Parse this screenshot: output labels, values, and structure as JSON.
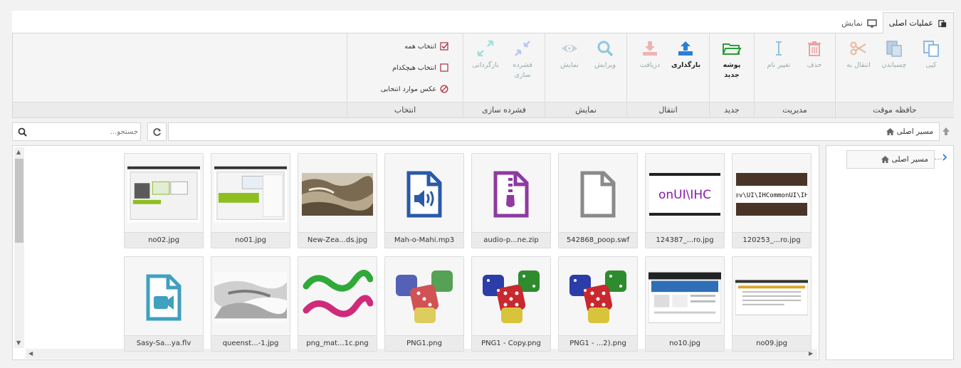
{
  "tabs": [
    {
      "label": "عملیات اصلی",
      "icon": "clipboard-icon",
      "active": true
    },
    {
      "label": "نمایش",
      "icon": "monitor-icon",
      "active": false
    }
  ],
  "ribbon": {
    "groups": {
      "clipboard": {
        "title": "حافظه موقت",
        "copy": "کپی",
        "paste": "چسباندن",
        "move": "انتقال به"
      },
      "manage": {
        "title": "مدیریت",
        "delete": "حذف",
        "rename": "تغییر نام"
      },
      "new": {
        "title": "جدید",
        "new_folder": "پوشه جدید"
      },
      "transfer": {
        "title": "انتقال",
        "upload": "بارگذاری",
        "download": "دریافت"
      },
      "view": {
        "title": "نمایش",
        "edit": "ویرایش",
        "show": "نمایش"
      },
      "compress": {
        "title": "فشرده سازی",
        "compress": "فشرده سازی",
        "extract": "بازگردانی"
      },
      "select": {
        "title": "انتخاب",
        "select_all": "انتخاب همه",
        "select_none": "انتخاب هیچکدام",
        "invert": "عکس موارد انتخابی"
      }
    }
  },
  "address": {
    "breadcrumb": "مسیر اصلی"
  },
  "search": {
    "placeholder": "جستجو..."
  },
  "tree": {
    "root": "مسیر اصلی"
  },
  "files": [
    {
      "name": "120253_...ro.jpg",
      "kind": "banner-ihc-image"
    },
    {
      "name": "124387_...ro.jpg",
      "kind": "banner-ihc-purple-image"
    },
    {
      "name": "542868_poop.swf",
      "kind": "blank-file-icon"
    },
    {
      "name": "audio-p...ne.zip",
      "kind": "zip-file-icon"
    },
    {
      "name": "Mah-o-Mahi.mp3",
      "kind": "audio-file-icon"
    },
    {
      "name": "New-Zea...ds.jpg",
      "kind": "landscape-image"
    },
    {
      "name": "no01.jpg",
      "kind": "screenshot-green-image"
    },
    {
      "name": "no02.jpg",
      "kind": "screenshot-image"
    },
    {
      "name": "no09.jpg",
      "kind": "webpage-image"
    },
    {
      "name": "no10.jpg",
      "kind": "webpage-blue-image"
    },
    {
      "name": "PNG1 - ...2).png",
      "kind": "dice-image"
    },
    {
      "name": "PNG1 - Copy.png",
      "kind": "dice-image"
    },
    {
      "name": "PNG1.png",
      "kind": "dice-blurred-image"
    },
    {
      "name": "png_mat...1c.png",
      "kind": "ribbons-image"
    },
    {
      "name": "queenst...-1.jpg",
      "kind": "grayscale-image"
    },
    {
      "name": "Sasy-Sa...ya.flv",
      "kind": "video-file-icon"
    }
  ],
  "colors": {
    "accent": "#3b8de0",
    "upload": "#2a7fd6",
    "folder": "#2f9a3c",
    "zip": "#8e3aa0",
    "audio": "#2a5aa8",
    "video": "#3fa0c0",
    "disabled": "#9fb8cc"
  }
}
